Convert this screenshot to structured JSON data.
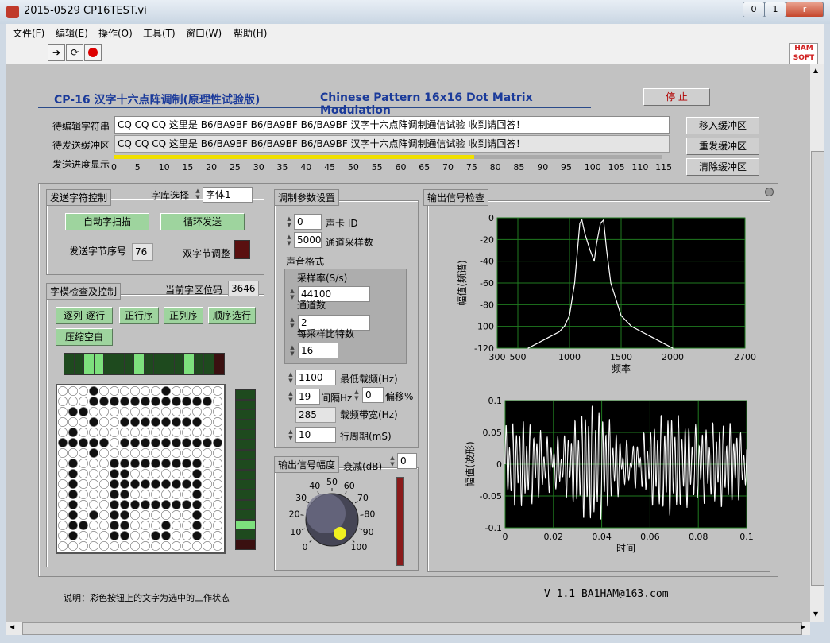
{
  "window": {
    "title": "2015-0529 CP16TEST.vi",
    "min": "0",
    "max": "1",
    "close": "r"
  },
  "menu": [
    {
      "label": "文件(F)"
    },
    {
      "label": "编辑(E)"
    },
    {
      "label": "操作(O)"
    },
    {
      "label": "工具(T)"
    },
    {
      "label": "窗口(W)"
    },
    {
      "label": "帮助(H)"
    }
  ],
  "toolbar": {
    "logo_line1": "HAM",
    "logo_line2": "SOFT"
  },
  "header": {
    "title_cn": "CP-16  汉字十六点阵调制(原理性试验版)",
    "title_en": "Chinese Pattern 16x16 Dot Matrix Modulation",
    "stop_button": "停 止"
  },
  "strings": {
    "edit_label": "待编辑字符串",
    "edit_value": "CQ CQ CQ 这里是 B6/BA9BF  B6/BA9BF  B6/BA9BF  汉字十六点阵调制通信试验  收到请回答！",
    "buffer_label": "待发送缓冲区",
    "buffer_value": "CQ CQ CQ 这里是 B6/BA9BF  B6/BA9BF  B6/BA9BF  汉字十六点阵调制通信试验  收到请回答！",
    "progress_label": "发送进度显示",
    "progress_value": 76,
    "progress_ticks": [
      "0",
      "5",
      "10",
      "15",
      "20",
      "25",
      "30",
      "35",
      "40",
      "45",
      "50",
      "55",
      "60",
      "65",
      "70",
      "75",
      "80",
      "85",
      "90",
      "95",
      "100",
      "105",
      "110",
      "115"
    ],
    "move_btn": "移入缓冲区",
    "resend_btn": "重发缓冲区",
    "clear_btn": "清除缓冲区"
  },
  "send_ctrl": {
    "title": "发送字符控制",
    "font_label": "字库选择",
    "font_value": "字体1",
    "auto_btn": "自动字扫描",
    "loop_btn": "循环发送",
    "byte_label": "发送字节序号",
    "byte_value": "76",
    "double_label": "双字节调整"
  },
  "glyph_ctrl": {
    "title": "字模检查及控制",
    "code_label": "当前字区位码",
    "code_value": "3646",
    "btn1": "逐列-逐行",
    "btn2": "正行序",
    "btn3": "正列序",
    "btn4": "顺序选行",
    "btn5": "压缩空白"
  },
  "mod": {
    "title": "调制参数设置",
    "card_value": "0",
    "card_label": "声卡 ID",
    "rate_value": "5000",
    "rate_label": "通道采样数",
    "format_label": "声音格式",
    "srate_label": "采样率(S/s)",
    "srate_value": "44100",
    "ch_label": "通道数",
    "ch_value": "2",
    "bits_label": "每采样比特数",
    "bits_value": "16",
    "minfreq_value": "1100",
    "minfreq_label": "最低载频(Hz)",
    "step_value": "19",
    "step_label": "间隔Hz",
    "offset_value": "0",
    "offset_label": "偏移%",
    "bw_value": "285",
    "bw_label": "载频带宽(Hz)",
    "period_value": "10",
    "period_label": "行周期(mS)"
  },
  "amp": {
    "title": "输出信号幅度",
    "atten_label": "衰减(dB)",
    "atten_value": "0",
    "knob_ticks": [
      "0",
      "10",
      "20",
      "30",
      "40",
      "50",
      "60",
      "70",
      "80",
      "90",
      "100"
    ]
  },
  "output": {
    "title": "输出信号检查"
  },
  "footer": {
    "note": "说明：彩色按钮上的文字为选中的工作状态",
    "version": "V 1.1   BA1HAM@163.com"
  },
  "chart_data": [
    {
      "type": "line",
      "xlabel": "频率",
      "ylabel": "幅值(频谱)",
      "xlim": [
        300,
        2700
      ],
      "ylim": [
        -120,
        0
      ],
      "x_ticks": [
        "300",
        "500",
        "1000",
        "1500",
        "2000",
        "2700"
      ],
      "y_ticks": [
        "0",
        "-20",
        "-40",
        "-60",
        "-80",
        "-100",
        "-120"
      ],
      "grid": true,
      "color": "#ffffff",
      "x": [
        600,
        700,
        800,
        900,
        950,
        1000,
        1050,
        1100,
        1120,
        1150,
        1200,
        1240,
        1260,
        1300,
        1330,
        1360,
        1400,
        1500,
        1600,
        1700,
        1800,
        1900,
        2000
      ],
      "y": [
        -120,
        -115,
        -110,
        -105,
        -100,
        -90,
        -60,
        -5,
        -2,
        -15,
        -30,
        -40,
        -25,
        -5,
        -2,
        -30,
        -60,
        -90,
        -100,
        -105,
        -110,
        -115,
        -120
      ]
    },
    {
      "type": "line",
      "xlabel": "时间",
      "ylabel": "幅值(波形)",
      "xlim": [
        0,
        0.1
      ],
      "ylim": [
        -0.1,
        0.1
      ],
      "x_ticks": [
        "0",
        "0.02",
        "0.04",
        "0.06",
        "0.08",
        "0.1"
      ],
      "y_ticks": [
        "0.1",
        "0.05",
        "0",
        "-0.05",
        "-0.1"
      ],
      "grid": true,
      "color": "#ffffff"
    }
  ],
  "colors": {
    "accent": "#1a3a9a",
    "led_green": "#7de07d",
    "led_dark": "#1e4a1e",
    "progress": "#f0e000",
    "plot_bg": "#000000",
    "plot_grid": "#1f7a1f"
  }
}
